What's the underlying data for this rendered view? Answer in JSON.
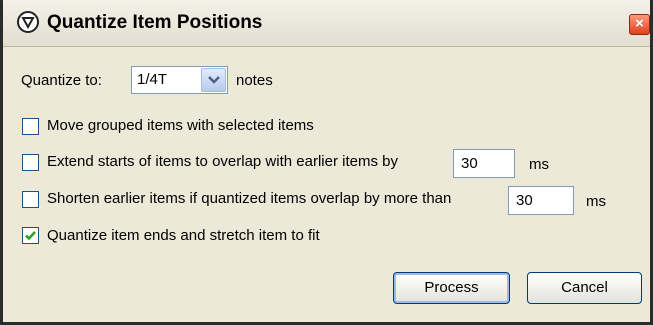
{
  "window": {
    "title": "Quantize Item Positions",
    "close_label": "×"
  },
  "quantize": {
    "label": "Quantize to:",
    "value": "1/4T",
    "unit": "notes"
  },
  "options": [
    {
      "label": "Move grouped items with selected items",
      "checked": false
    },
    {
      "label": "Extend starts of items to overlap with earlier items by",
      "checked": false,
      "value": "30",
      "unit": "ms"
    },
    {
      "label": "Shorten earlier items if quantized items overlap by more than",
      "checked": false,
      "value": "30",
      "unit": "ms"
    },
    {
      "label": "Quantize item ends and stretch item to fit",
      "checked": true
    }
  ],
  "buttons": {
    "process": "Process",
    "cancel": "Cancel"
  }
}
